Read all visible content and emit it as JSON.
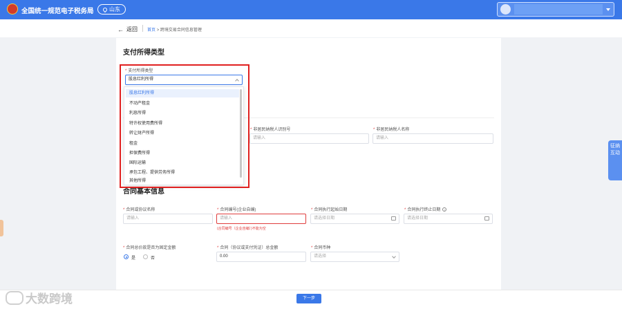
{
  "header": {
    "site_title": "全国统一规范电子税务局",
    "region": "山东",
    "user_name": ""
  },
  "breadcrumb": {
    "back_label": "返回",
    "home": "首页",
    "current": "跨境交易合同信息管理"
  },
  "section1": {
    "title": "支付所得类型",
    "field_label": "支付所得类型",
    "selected_value": "股息红利所得",
    "options": [
      "股息红利所得",
      "不动产租金",
      "利息所得",
      "特许权使用费所得",
      "转让财产所得",
      "租金",
      "担保费所得",
      "国际运输",
      "承包工程、提供劳务所得",
      "其他所得"
    ]
  },
  "section2": {
    "nonresident_id_label": "非居民纳税人识别号",
    "nonresident_id_placeholder": "请输入",
    "nonresident_name_label": "非居民纳税人名称",
    "nonresident_name_placeholder": "请输入"
  },
  "section3": {
    "title": "合同基本信息",
    "contract_name_label": "合同或协议名称",
    "contract_name_placeholder": "请输入",
    "contract_no_label": "合同编号(企业自编)",
    "contract_no_placeholder": "请输入",
    "contract_no_error": "(合同编号（企业自编）)不能为空",
    "start_date_label": "合同执行起始日期",
    "start_date_placeholder": "请选择日期",
    "end_date_label": "合同执行终止日期",
    "end_date_placeholder": "请选择日期",
    "fixed_amount_label": "合同总价款是否为固定金额",
    "radio_yes": "是",
    "radio_no": "否",
    "radio_selected": "是",
    "total_amount_label": "合同（协议或支付凭证）总金额",
    "total_amount_value": "0.00",
    "currency_label": "合同币种",
    "currency_placeholder": "请选择"
  },
  "footer": {
    "next_label": "下一步",
    "watermark": "大数跨境"
  },
  "side_tab": {
    "label": "征纳互动"
  },
  "colors": {
    "primary": "#3a78e8",
    "error": "#e03c3c",
    "highlight": "#e02020"
  }
}
